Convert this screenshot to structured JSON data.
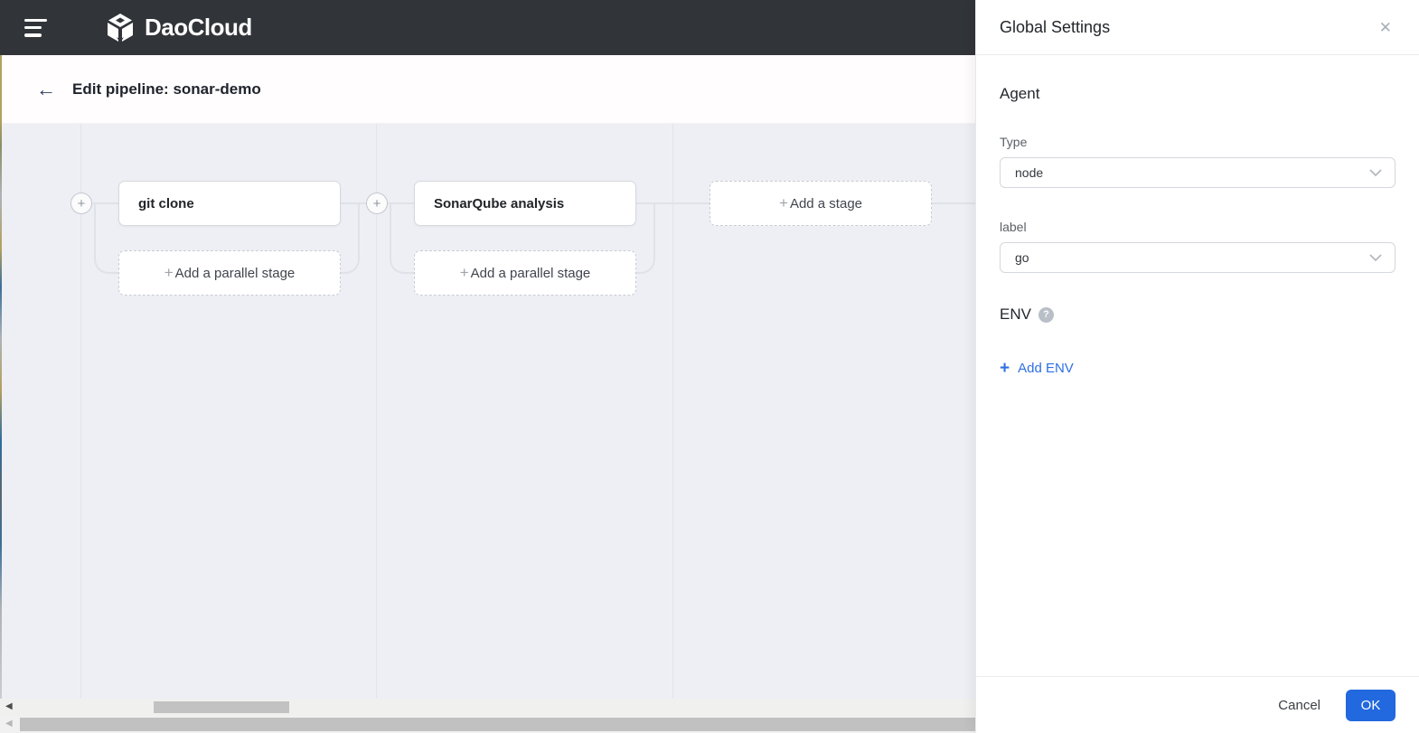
{
  "navbar": {
    "brand": "DaoCloud"
  },
  "header": {
    "title": "Edit pipeline: sonar-demo"
  },
  "canvas": {
    "stages": [
      {
        "name": "git clone"
      },
      {
        "name": "SonarQube analysis"
      }
    ],
    "add_stage_label": "Add a stage",
    "add_parallel_label": "Add a parallel stage"
  },
  "panel": {
    "title": "Global Settings",
    "agent_heading": "Agent",
    "type_label": "Type",
    "type_value": "node",
    "label_label": "label",
    "label_value": "go",
    "env_heading": "ENV",
    "add_env_label": "Add ENV",
    "cancel_label": "Cancel",
    "ok_label": "OK"
  },
  "icons": {
    "back": "←",
    "close": "✕",
    "plus": "+",
    "help": "?",
    "scroll_left": "◀"
  },
  "colors": {
    "navbar_bg": "#313438",
    "canvas_bg": "#edeff4",
    "accent_blue": "#2268df",
    "link_blue": "#2f6fe4"
  }
}
